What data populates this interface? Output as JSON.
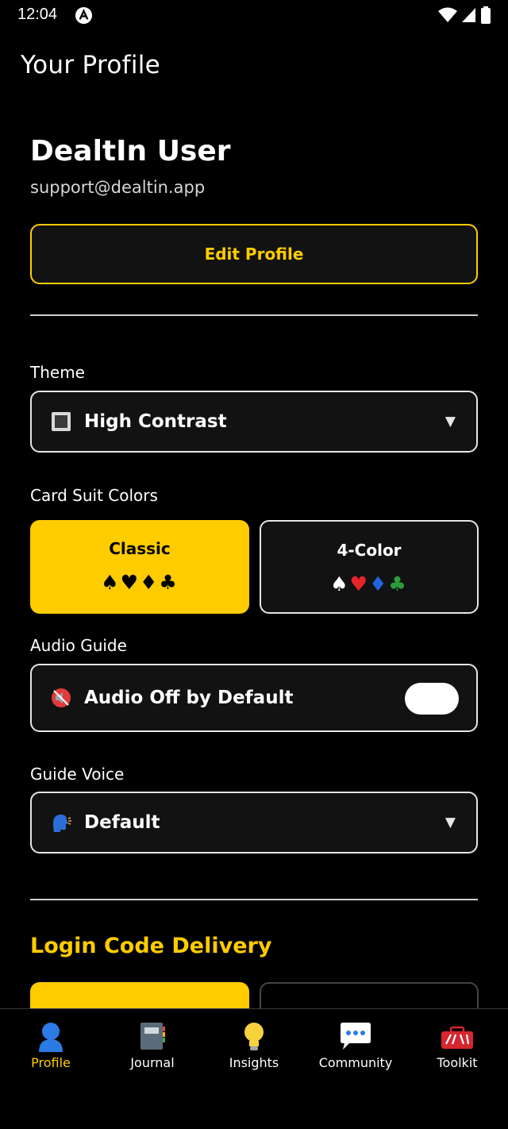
{
  "status": {
    "time": "12:04"
  },
  "header": {
    "title": "Your Profile"
  },
  "profile": {
    "name": "DealtIn User",
    "email": "support@dealtin.app",
    "edit_label": "Edit Profile"
  },
  "theme": {
    "label": "Theme",
    "value": "High Contrast",
    "icon": "square-icon"
  },
  "suits": {
    "label": "Card Suit Colors",
    "options": [
      {
        "title": "Classic",
        "suits": "♠♥♦♣",
        "selected": true
      },
      {
        "title": "4-Color",
        "suits": [
          "♠",
          "♥",
          "♦",
          "♣"
        ],
        "selected": false
      }
    ],
    "four_color_colors": [
      "#ffffff",
      "#e8242b",
      "#1e66e0",
      "#2a9d3a"
    ]
  },
  "audio": {
    "label": "Audio Guide",
    "toggle_label": "Audio Off by Default",
    "enabled": false,
    "icon": "muted-speaker-icon"
  },
  "voice": {
    "label": "Guide Voice",
    "value": "Default",
    "icon": "speaking-head-icon"
  },
  "login": {
    "title": "Login Code Delivery"
  },
  "tabs": [
    {
      "label": "Profile",
      "icon": "person-icon",
      "active": true
    },
    {
      "label": "Journal",
      "icon": "notebook-icon",
      "active": false
    },
    {
      "label": "Insights",
      "icon": "lightbulb-icon",
      "active": false
    },
    {
      "label": "Community",
      "icon": "speech-bubble-icon",
      "active": false
    },
    {
      "label": "Toolkit",
      "icon": "toolbox-icon",
      "active": false
    }
  ],
  "colors": {
    "accent": "#FFCC00",
    "background": "#000000",
    "surface": "#121212"
  }
}
